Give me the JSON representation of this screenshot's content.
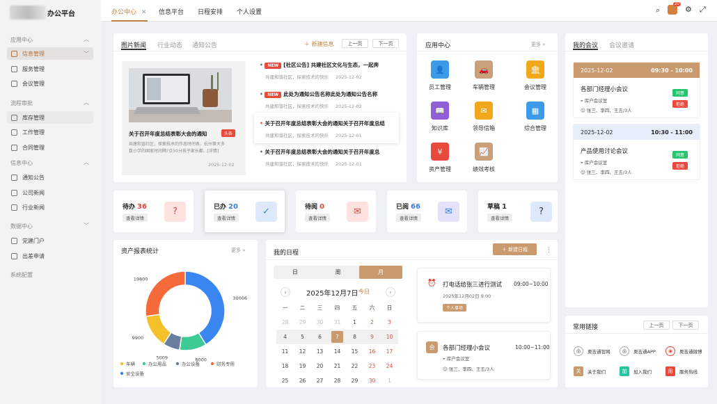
{
  "app": {
    "title_suffix": "办公平台"
  },
  "sidebar": {
    "groups": [
      {
        "label": "应用中心",
        "items": [
          "信息管理",
          "服务管理",
          "会议管理"
        ]
      },
      {
        "label": "流程审批",
        "items": [
          "库存管理",
          "工作管理",
          "合同管理"
        ]
      },
      {
        "label": "信息中心",
        "items": [
          "通知公告",
          "公司新闻",
          "行业新闻"
        ]
      },
      {
        "label": "数据中心",
        "items": [
          "党建门户",
          "出差申请"
        ]
      }
    ],
    "footer": "系统配置"
  },
  "topbar": {
    "tabs": [
      "办公中心",
      "信息平台",
      "日程安排",
      "个人设置"
    ],
    "badge": "20"
  },
  "news": {
    "tabs": [
      "图片新闻",
      "行业动态",
      "通知公告"
    ],
    "new_label": "新建信息",
    "prev": "上一页",
    "next": "下一页",
    "featured": {
      "title": "关于召开年度总结表彰大会的通知",
      "tag": "头条",
      "summary1": "共建和谐社区，探索技术的作息时间表，杭州第大多",
      "summary2": "数小学的国家时间隔?点50分孩子家长都...[详情]",
      "date": "2025-12-02"
    },
    "items": [
      {
        "new": "NEW",
        "title": "[社区公告] 共建社区文化与生态，一起奔",
        "meta": "共建和谐社区，探索技术的快乐",
        "date": "2025-12-02"
      },
      {
        "new": "NEW",
        "title": "此处为通知公告名称此处为通知公告名称",
        "meta": "共建和谐社区，探索技术的快乐",
        "date": "2025-12-02"
      },
      {
        "new": "",
        "title": "关于召开年度总结表彰大会的通知关于召开年度总结",
        "meta": "共建和谐社区，探索技术的快乐",
        "date": "2025-12-01"
      },
      {
        "new": "",
        "title": "关于召开年度总结表彰大会的通知关于召开年度总",
        "meta": "共建和谐社区，探索技术的快乐",
        "date": "2025-12-01"
      }
    ]
  },
  "apps": {
    "title": "应用中心",
    "more": "更多",
    "items": [
      {
        "label": "员工管理",
        "icon": "person-icon",
        "color": "#3b9be8"
      },
      {
        "label": "车辆管理",
        "icon": "car-icon",
        "color": "#c8a07a"
      },
      {
        "label": "会议管理",
        "icon": "meeting-icon",
        "color": "#f2a81d"
      },
      {
        "label": "知识库",
        "icon": "book-icon",
        "color": "#8e5fd6"
      },
      {
        "label": "领导信箱",
        "icon": "mail-icon",
        "color": "#f2a81d"
      },
      {
        "label": "综合管理",
        "icon": "grid-icon",
        "color": "#3b9be8"
      },
      {
        "label": "资产管理",
        "icon": "money-icon",
        "color": "#ea4a3e"
      },
      {
        "label": "绩效考核",
        "icon": "chart-icon",
        "color": "#c8a07a"
      }
    ]
  },
  "stats": [
    {
      "label": "待办",
      "value": "36",
      "detail": "查看详情",
      "color": "#e8453c",
      "bg": "#fde2e0",
      "icon": "doc-question-icon"
    },
    {
      "label": "已办",
      "value": "20",
      "detail": "查看详情",
      "color": "#3a7ee0",
      "bg": "#dde9fb",
      "icon": "doc-check-icon"
    },
    {
      "label": "待阅",
      "value": "0",
      "detail": "查看详情",
      "color": "#e8453c",
      "bg": "#fde2e0",
      "icon": "mail-icon"
    },
    {
      "label": "已阅",
      "value": "66",
      "detail": "查看详情",
      "color": "#3a7ee0",
      "bg": "#e4e2fb",
      "icon": "mail-open-icon"
    },
    {
      "label": "草稿",
      "value": "1",
      "detail": "查看详情",
      "color": "#333",
      "bg": "#dde9fb",
      "icon": "doc-question-icon"
    }
  ],
  "chart_data": {
    "type": "pie",
    "title": "资产报表统计",
    "more": "更多",
    "slices": [
      {
        "name": "车辆",
        "value": 9900,
        "label": "9900",
        "color": "#f5c12a"
      },
      {
        "name": "办公用品",
        "value": 8000,
        "label": "8000",
        "color": "#3ccb92"
      },
      {
        "name": "办公设备",
        "value": 5009,
        "label": "5009",
        "color": "#6a7fa0"
      },
      {
        "name": "财务专用",
        "value": 19800,
        "label": "19800",
        "color": "#f56a3b"
      },
      {
        "name": "安全设备",
        "value": 30006,
        "label": "30006",
        "color": "#3a86f0"
      }
    ]
  },
  "schedule": {
    "title": "我的日程",
    "new_label": "新建日程",
    "views": [
      "日",
      "周",
      "月"
    ],
    "date_label": "2025年12月7日",
    "today": "今日",
    "weekdays": [
      "一",
      "二",
      "三",
      "四",
      "五",
      "六",
      "日"
    ],
    "weeks": [
      [
        "28",
        "29",
        "30",
        "31",
        "1",
        "2",
        "3"
      ],
      [
        "4",
        "5",
        "6",
        "7",
        "8",
        "9",
        "10"
      ],
      [
        "11",
        "12",
        "13",
        "14",
        "15",
        "16",
        "17"
      ],
      [
        "18",
        "19",
        "20",
        "21",
        "22",
        "23",
        "24"
      ],
      [
        "25",
        "26",
        "27",
        "28",
        "29",
        "30",
        "1"
      ]
    ],
    "events": [
      {
        "title": "打电话给张三进行测试",
        "time": "09:00~10:00",
        "sub": "2025年12月02日 9:00",
        "tag": "个人事项"
      },
      {
        "title": "各部门经理小会议",
        "time": "10:00~11:00",
        "room": "库户会议室",
        "people": "张三、李四、王五/3人",
        "badge": "会"
      }
    ]
  },
  "meetings": {
    "tabs": [
      "我的会议",
      "会议邀请"
    ],
    "items": [
      {
        "date": "2025-12-02",
        "time": "09:30 - 10:00",
        "title": "各部门经理小会议",
        "room": "库户会议室",
        "people": "张三、李四、王五/3人",
        "accept": "同意",
        "reject": "拒绝"
      },
      {
        "date": "2025-12-02",
        "time": "10:30 - 11:00",
        "title": "产品使用讨论会议",
        "room": "库户会议室",
        "people": "张三、李四、王五/3人",
        "accept": "同意",
        "reject": "拒绝"
      }
    ]
  },
  "links": {
    "title": "常用链接",
    "prev": "上一页",
    "next": "下一页",
    "items": [
      {
        "label": "奥吉通官网",
        "badge": ""
      },
      {
        "label": "奥吉通APP",
        "badge": ""
      },
      {
        "label": "奥吉通微博",
        "badge": ""
      },
      {
        "label": "关于我们",
        "badge": "关"
      },
      {
        "label": "加入我们",
        "badge": "加"
      },
      {
        "label": "服务热线",
        "badge": "用"
      }
    ]
  }
}
